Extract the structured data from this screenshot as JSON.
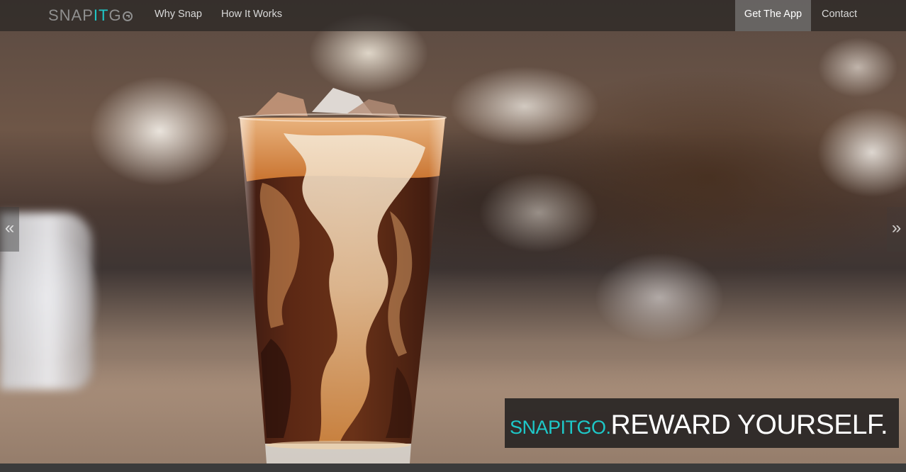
{
  "navbar": {
    "logo": {
      "part1": "SNAP",
      "part2": "IT",
      "part3": "G"
    },
    "links": [
      {
        "label": "Why Snap"
      },
      {
        "label": "How It Works"
      }
    ],
    "cta": {
      "label": "Get The App"
    },
    "contact": {
      "label": "Contact"
    }
  },
  "carousel": {
    "prev_glyph": "«",
    "next_glyph": "»"
  },
  "caption": {
    "brand": "SNAPITGO.",
    "headline": "REWARD YOURSELF."
  },
  "colors": {
    "accent": "#1ec8c8",
    "navbar_bg": "#282624",
    "caption_bg": "#222020"
  }
}
